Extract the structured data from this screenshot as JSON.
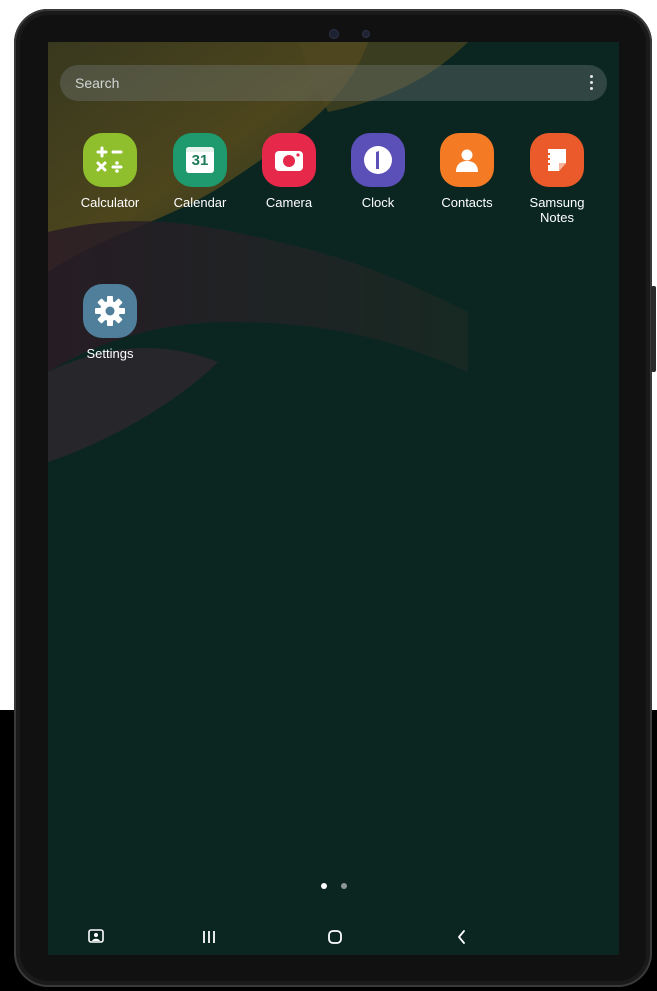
{
  "search": {
    "placeholder": "Search",
    "menu_icon": "more-vertical-icon"
  },
  "apps": [
    {
      "label": "Calculator",
      "icon": "calculator-icon",
      "color": "#8fbf2c"
    },
    {
      "label": "Calendar",
      "icon": "calendar-icon",
      "color": "#1f9a6e",
      "icon_text": "31"
    },
    {
      "label": "Camera",
      "icon": "camera-icon",
      "color": "#e6284a"
    },
    {
      "label": "Clock",
      "icon": "clock-icon",
      "color": "#5b4fb8"
    },
    {
      "label": "Contacts",
      "icon": "contacts-icon",
      "color": "#f47a24"
    },
    {
      "label": "Samsung\nNotes",
      "icon": "samsung-notes-icon",
      "color": "#ea5a2a"
    },
    {
      "label": "Settings",
      "icon": "settings-gear-icon",
      "color": "#4f7f9a"
    }
  ],
  "page_indicator": {
    "pages": 2,
    "current": 1
  },
  "navbar": {
    "buttons": [
      {
        "name": "screenshot-icon"
      },
      {
        "name": "recent-apps-icon"
      },
      {
        "name": "home-icon"
      },
      {
        "name": "back-icon"
      }
    ]
  },
  "colors": {
    "screen_background": "#0b2621",
    "label_text": "#ffffff",
    "indicator_active": "#ffffff",
    "indicator_inactive": "#8a9694"
  }
}
